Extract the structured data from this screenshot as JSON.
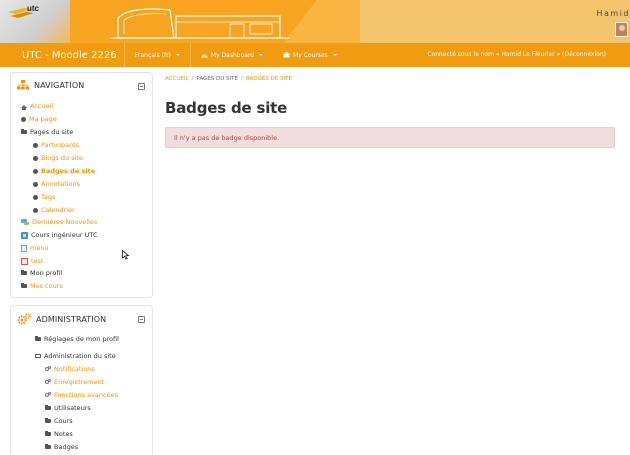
{
  "banner": {
    "logo_text": "utc",
    "user_name": "Hamid"
  },
  "navbar": {
    "site_name": "UTC - Moodle 2226",
    "menus": [
      {
        "label": "Français (fr)",
        "icon": "none"
      },
      {
        "label": "My Dashboard",
        "icon": "dashboard-icon"
      },
      {
        "label": "My Courses",
        "icon": "briefcase-icon"
      }
    ],
    "logged_in": "Connecté sous le nom « Hamid Le Fleurler » (Déconnexion)"
  },
  "navigation": {
    "title": "NAVIGATION",
    "items": [
      {
        "label": "Accueil",
        "icon": "home-icon",
        "style": "link"
      },
      {
        "label": "Ma page",
        "icon": "dot-icon",
        "style": "link"
      },
      {
        "label": "Pages du site",
        "icon": "folder-icon",
        "style": "plain"
      },
      {
        "label": "Participants",
        "icon": "dot-icon",
        "style": "link"
      },
      {
        "label": "Blogs du site",
        "icon": "dot-icon",
        "style": "link"
      },
      {
        "label": "Badges de site",
        "icon": "dot-icon",
        "style": "link-bold"
      },
      {
        "label": "Annotations",
        "icon": "dot-icon",
        "style": "link"
      },
      {
        "label": "Tags",
        "icon": "dot-icon",
        "style": "link"
      },
      {
        "label": "Calendrier",
        "icon": "dot-icon",
        "style": "link"
      },
      {
        "label": "Dernières Nouvelles",
        "icon": "forum-icon",
        "style": "link"
      },
      {
        "label": "Cours ingénieur UTC",
        "icon": "course-icon",
        "style": "plain"
      },
      {
        "label": "menu",
        "icon": "page-icon",
        "style": "link"
      },
      {
        "label": "test",
        "icon": "page-icon",
        "style": "link"
      },
      {
        "label": "Mon profil",
        "icon": "folder-icon",
        "style": "plain"
      },
      {
        "label": "Mes cours",
        "icon": "folder-icon",
        "style": "link"
      }
    ]
  },
  "administration": {
    "title": "ADMINISTRATION",
    "items": [
      {
        "label": "Réglages de mon profil",
        "icon": "folder-icon",
        "style": "plain"
      },
      {
        "label": "Administration du site",
        "icon": "folder-open-icon",
        "style": "plain"
      },
      {
        "label": "Notifications",
        "icon": "gear-icon",
        "style": "link"
      },
      {
        "label": "Enregistrement",
        "icon": "gear-icon",
        "style": "link"
      },
      {
        "label": "Fonctions avancées",
        "icon": "gear-icon",
        "style": "link"
      },
      {
        "label": "Utilisateurs",
        "icon": "folder-icon",
        "style": "plain"
      },
      {
        "label": "Cours",
        "icon": "folder-icon",
        "style": "plain"
      },
      {
        "label": "Notes",
        "icon": "folder-icon",
        "style": "plain"
      },
      {
        "label": "Badges",
        "icon": "folder-icon",
        "style": "plain"
      }
    ]
  },
  "breadcrumb": {
    "items": [
      "Accueil",
      "Pages du site",
      "Badges de site"
    ],
    "separator": "/"
  },
  "main": {
    "title": "Badges de site",
    "alert": "Il n'y a pas de badge disponible."
  },
  "colors": {
    "banner": "#f7a420",
    "navbar": "#f19b10",
    "link": "#f0950b",
    "alert_bg": "#f2dede",
    "alert_text": "#a94442"
  }
}
